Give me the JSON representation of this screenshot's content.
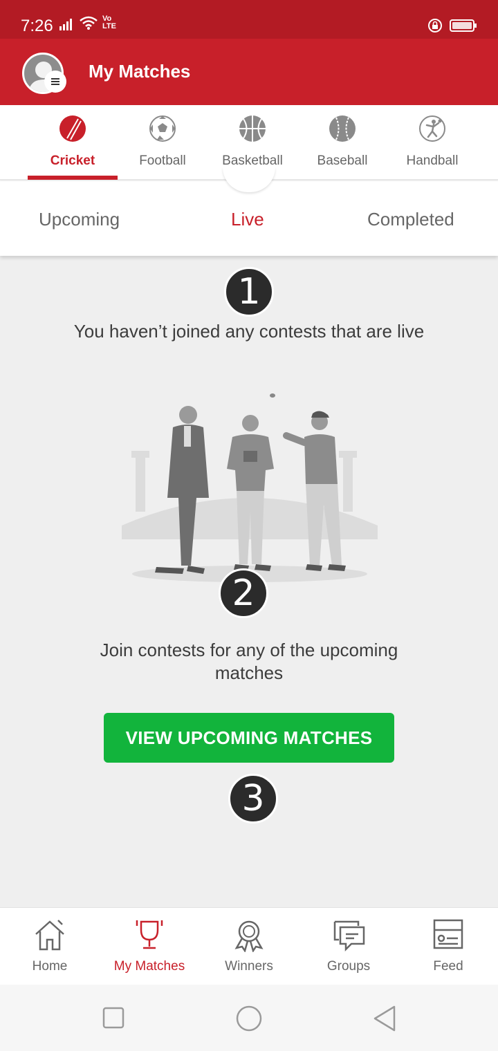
{
  "status_bar": {
    "time": "7:26",
    "network_label": "Vo LTE"
  },
  "app_bar": {
    "title": "My Matches",
    "avatar_icon": "avatar-icon",
    "menu_icon": "menu-icon"
  },
  "sport_tabs": [
    {
      "label": "Cricket",
      "icon": "cricket-ball-icon",
      "active": true
    },
    {
      "label": "Football",
      "icon": "football-icon",
      "active": false
    },
    {
      "label": "Basketball",
      "icon": "basketball-icon",
      "active": false
    },
    {
      "label": "Baseball",
      "icon": "baseball-icon",
      "active": false
    },
    {
      "label": "Handball",
      "icon": "handball-icon",
      "active": false
    }
  ],
  "match_tabs": [
    {
      "label": "Upcoming",
      "active": false
    },
    {
      "label": "Live",
      "active": true
    },
    {
      "label": "Completed",
      "active": false
    }
  ],
  "empty_state": {
    "title": "You haven’t joined any contests that are live",
    "subtitle": "Join contests for any of the upcoming matches",
    "button_label": "VIEW UPCOMING MATCHES"
  },
  "step_markers": [
    "1",
    "2",
    "3"
  ],
  "bottom_nav": [
    {
      "label": "Home",
      "icon": "home-icon",
      "active": false
    },
    {
      "label": "My Matches",
      "icon": "trophy-icon",
      "active": true
    },
    {
      "label": "Winners",
      "icon": "award-ribbon-icon",
      "active": false
    },
    {
      "label": "Groups",
      "icon": "chat-icon",
      "active": false
    },
    {
      "label": "Feed",
      "icon": "feed-card-icon",
      "active": false
    }
  ],
  "colors": {
    "brand_red": "#c8202a",
    "status_bar": "#b31b24",
    "cta_green": "#12b43c",
    "inactive_text": "#666666"
  }
}
